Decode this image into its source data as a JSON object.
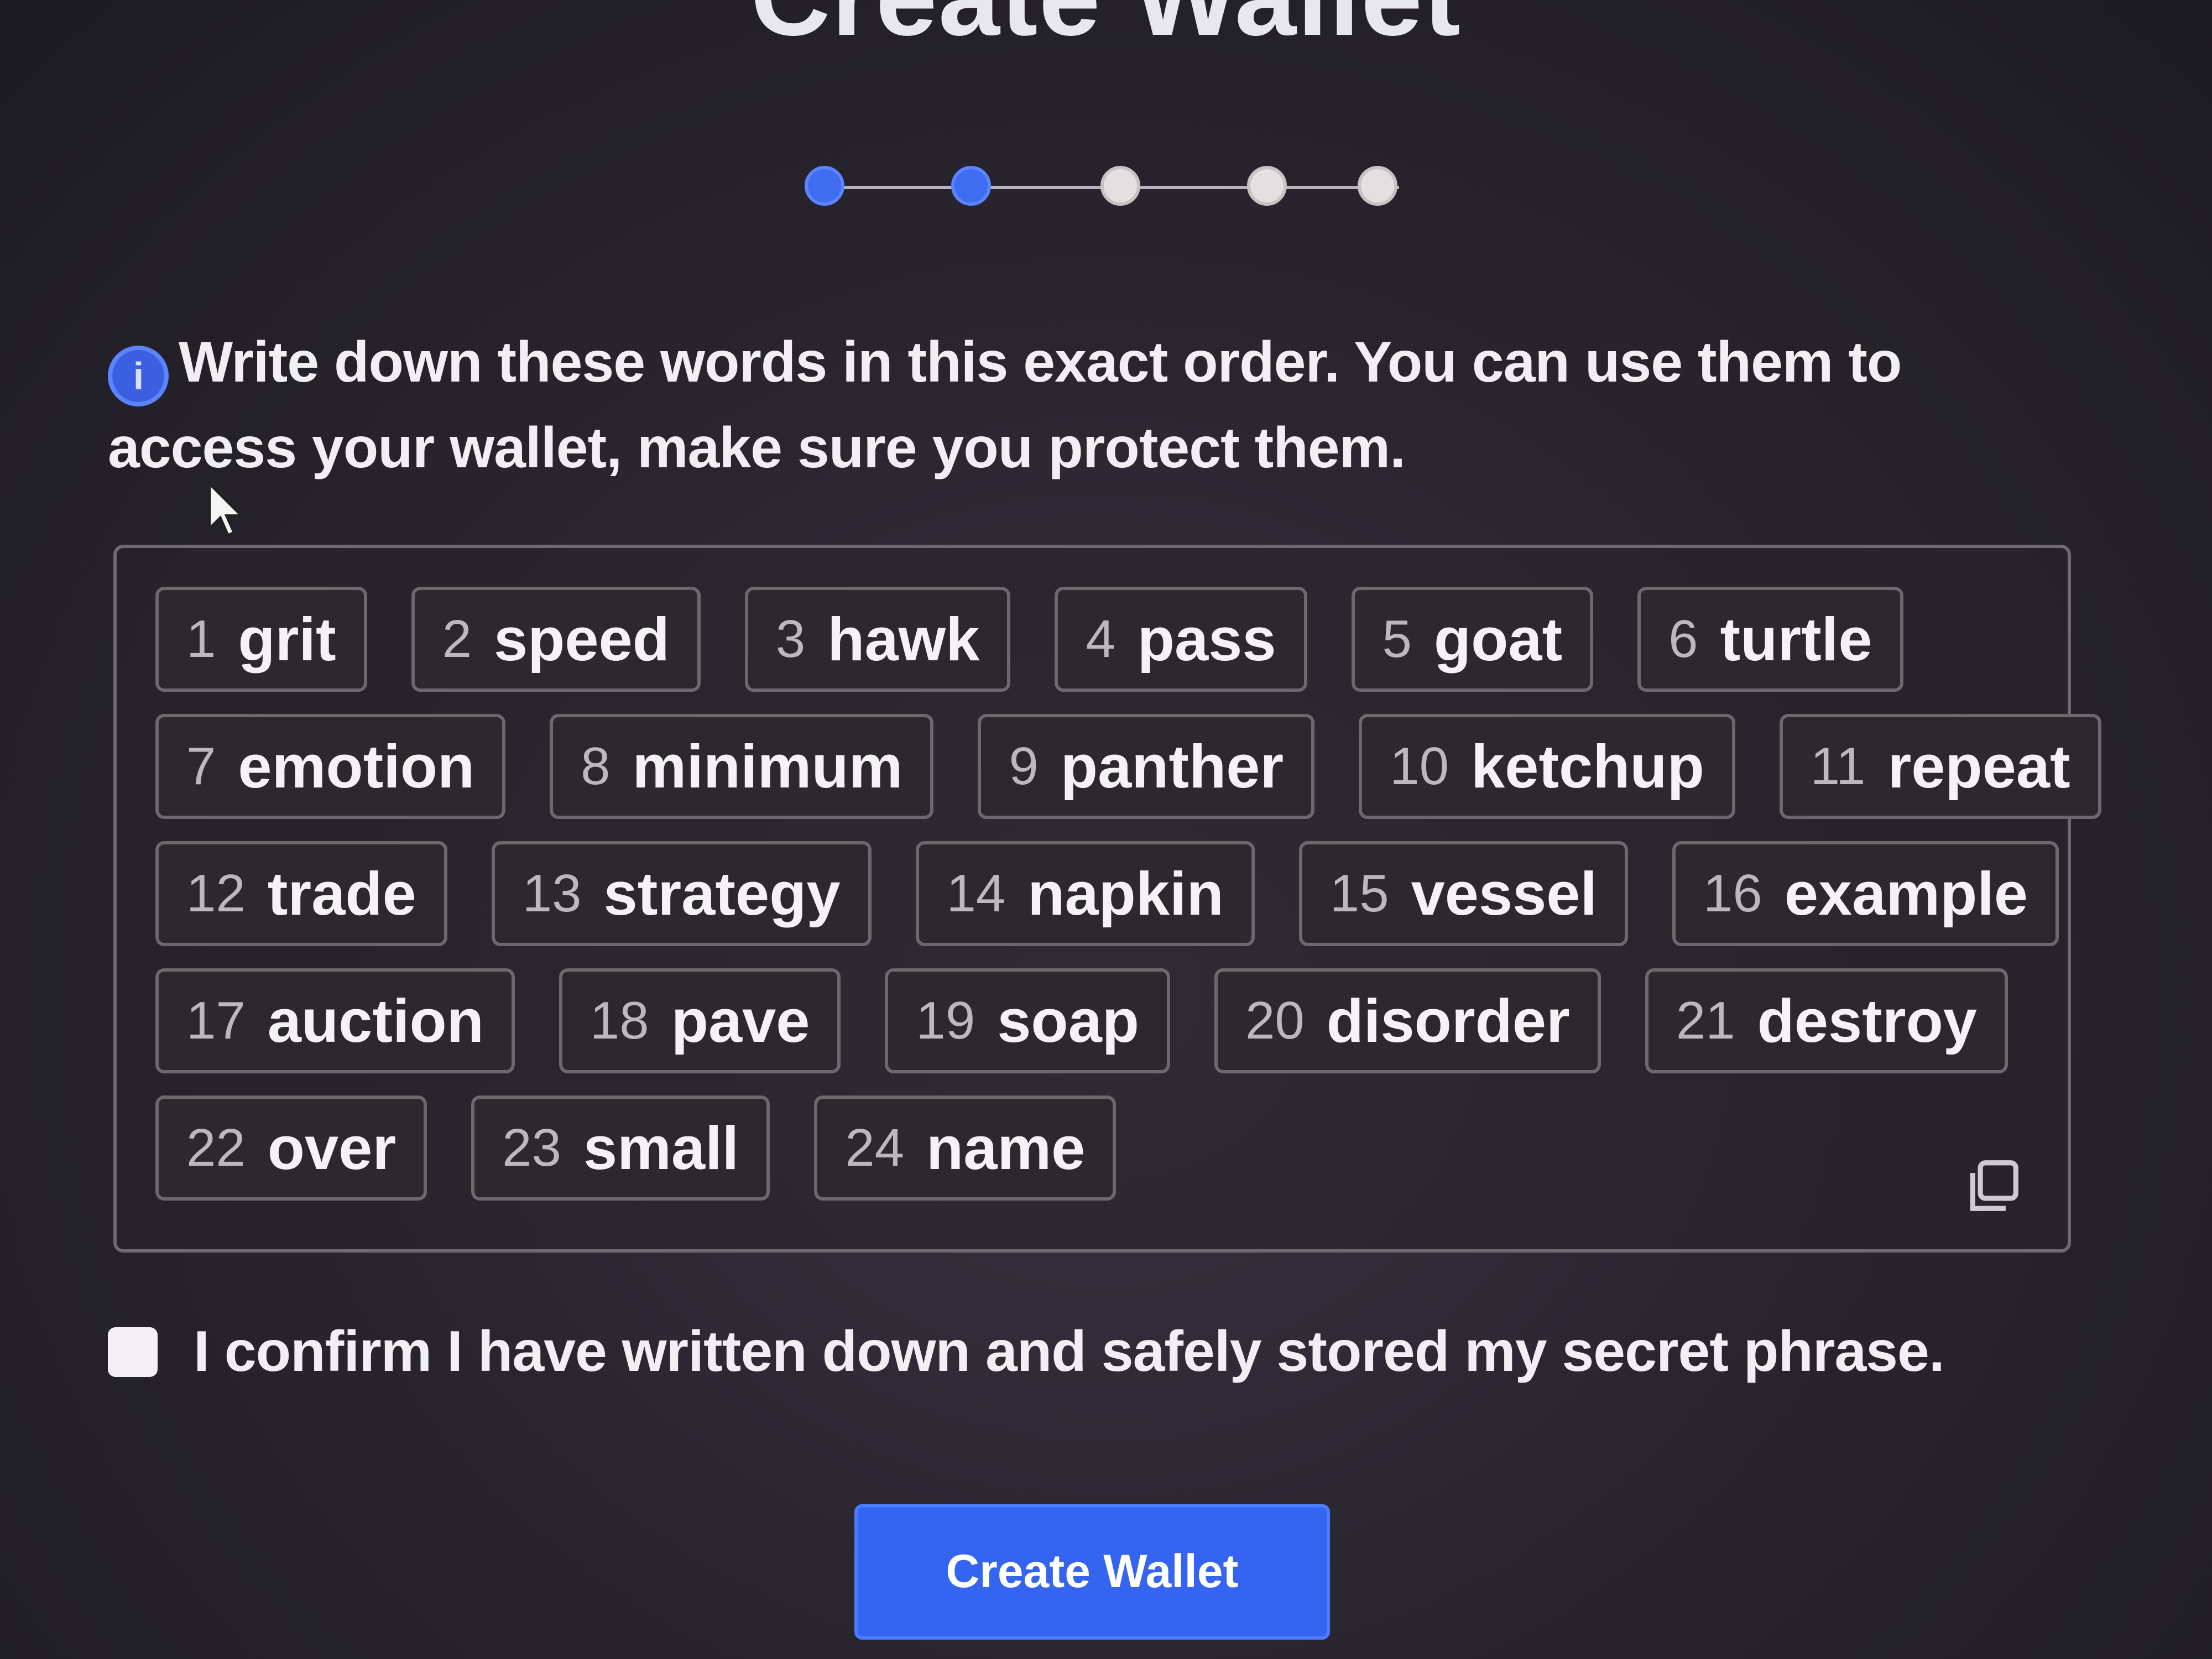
{
  "page": {
    "title": "Create Wallet",
    "steps": [
      {
        "state": "complete"
      },
      {
        "state": "current"
      },
      {
        "state": "pending"
      },
      {
        "state": "pending"
      },
      {
        "state": "pending"
      }
    ]
  },
  "instruction": {
    "icon": "info-icon",
    "text": "Write down these words in this exact order. You can use them to access your wallet, make sure you protect them."
  },
  "phrase": {
    "rows": [
      [
        {
          "num": "1",
          "word": "grit"
        },
        {
          "num": "2",
          "word": "speed"
        },
        {
          "num": "3",
          "word": "hawk"
        },
        {
          "num": "4",
          "word": "pass"
        },
        {
          "num": "5",
          "word": "goat"
        },
        {
          "num": "6",
          "word": "turtle"
        }
      ],
      [
        {
          "num": "7",
          "word": "emotion"
        },
        {
          "num": "8",
          "word": "minimum"
        },
        {
          "num": "9",
          "word": "panther"
        },
        {
          "num": "10",
          "word": "ketchup"
        },
        {
          "num": "11",
          "word": "repeat"
        }
      ],
      [
        {
          "num": "12",
          "word": "trade"
        },
        {
          "num": "13",
          "word": "strategy"
        },
        {
          "num": "14",
          "word": "napkin"
        },
        {
          "num": "15",
          "word": "vessel"
        },
        {
          "num": "16",
          "word": "example"
        }
      ],
      [
        {
          "num": "17",
          "word": "auction"
        },
        {
          "num": "18",
          "word": "pave"
        },
        {
          "num": "19",
          "word": "soap"
        },
        {
          "num": "20",
          "word": "disorder"
        },
        {
          "num": "21",
          "word": "destroy"
        }
      ],
      [
        {
          "num": "22",
          "word": "over"
        },
        {
          "num": "23",
          "word": "small"
        },
        {
          "num": "24",
          "word": "name"
        }
      ]
    ],
    "copy_icon": "copy-icon"
  },
  "confirm": {
    "checked": false,
    "label": "I confirm I have written down and safely stored my secret phrase."
  },
  "actions": {
    "create_label": "Create Wallet",
    "primary_color": "#3565f0"
  }
}
